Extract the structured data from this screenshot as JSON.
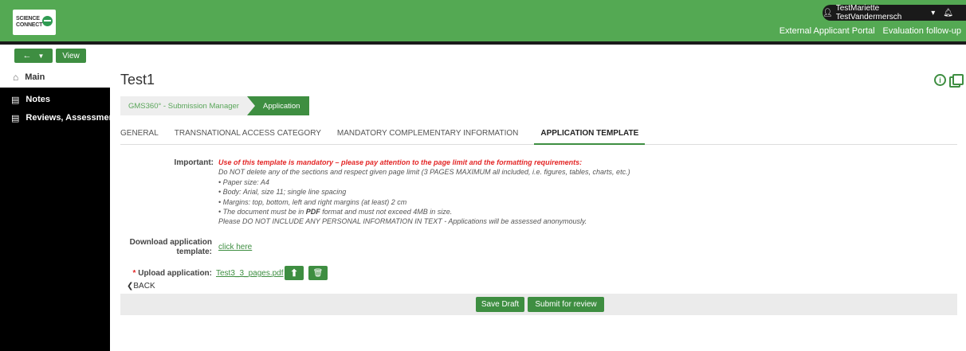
{
  "header": {
    "logo_line1": "SCIENCE",
    "logo_line2": "CONNECT",
    "user_name": "TestMariette TestVandermersch",
    "links": [
      "External Applicant Portal",
      "Evaluation follow-up"
    ]
  },
  "toolbar": {
    "view_label": "View"
  },
  "sidebar": {
    "items": [
      {
        "label": "Main",
        "icon": "home-icon"
      },
      {
        "label": "Notes",
        "icon": "document-icon"
      },
      {
        "label": "Reviews, Assessmen...",
        "icon": "list-icon"
      }
    ]
  },
  "page": {
    "title": "Test1"
  },
  "breadcrumb": {
    "item1": "GMS360° - Submission Manager",
    "item2": "Application"
  },
  "tabs": [
    {
      "label": "GENERAL"
    },
    {
      "label": "TRANSNATIONAL ACCESS CATEGORY"
    },
    {
      "label": "MANDATORY COMPLEMENTARY INFORMATION"
    },
    {
      "label": "APPLICATION TEMPLATE",
      "active": true
    }
  ],
  "form": {
    "important_label": "Important:",
    "important_heading": "Use of this template is mandatory – please pay attention to the page limit and the formatting requirements:",
    "lines": [
      "Do NOT delete any of the sections and respect given page limit (3 PAGES MAXIMUM all included, i.e. figures, tables, charts, etc.)",
      "• Paper size: A4",
      "• Body: Arial, size 11; single line spacing",
      "• Margins: top, bottom, left and right margins (at least) 2 cm"
    ],
    "line_format_pre": "• The document must be in ",
    "line_format_bold": "PDF",
    "line_format_post": " format and must not exceed 4MB in size.",
    "line_personal": "Please DO NOT INCLUDE ANY PERSONAL INFORMATION IN TEXT - Applications will be assessed anonymously.",
    "download_label_1": "Download application",
    "download_label_2": "template:",
    "download_link": "click here",
    "upload_required_mark": "*",
    "upload_label": "Upload application:",
    "upload_file": "Test3_3_pages.pdf"
  },
  "footer": {
    "back_label": "BACK",
    "save_label": "Save Draft",
    "submit_label": "Submit for review"
  },
  "colors": {
    "brand_green": "#54a953",
    "button_green": "#3e8e41",
    "required_red": "#e32626"
  }
}
